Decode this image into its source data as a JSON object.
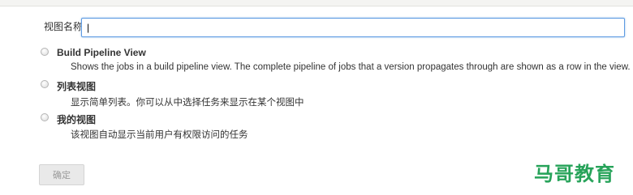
{
  "form": {
    "name_label": "视图名称",
    "name_value": "|",
    "ok_label": "确定"
  },
  "options": [
    {
      "title": "Build Pipeline View",
      "description": "Shows the jobs in a build pipeline view. The complete pipeline of jobs that a version propagates through are shown as a row in the view."
    },
    {
      "title": "列表视图",
      "description": "显示简单列表。你可以从中选择任务来显示在某个视图中"
    },
    {
      "title": "我的视图",
      "description": "该视图自动显示当前用户有权限访问的任务"
    }
  ],
  "watermark": {
    "text": "马哥教育",
    "color": "#27a35a"
  }
}
